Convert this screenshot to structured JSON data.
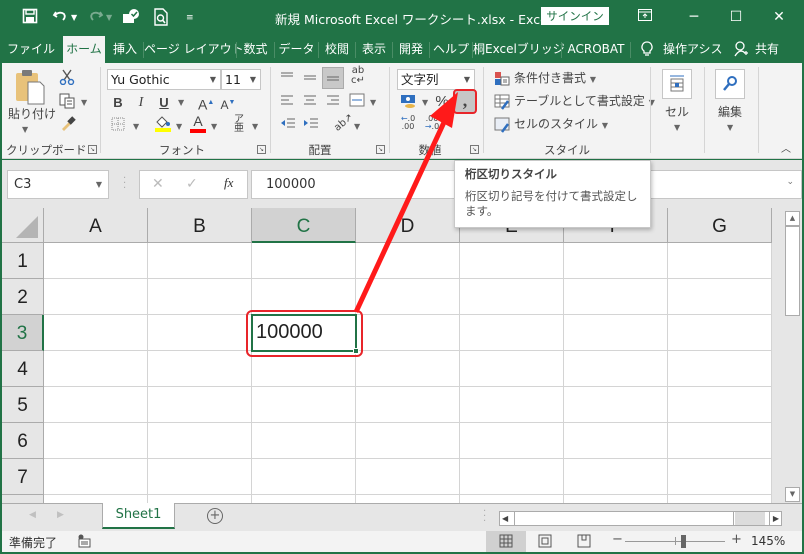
{
  "title_bar": {
    "title": "新規 Microsoft Excel ワークシート.xlsx  -  Excel",
    "signin_label": "サインイン",
    "quick_access": [
      "save",
      "undo",
      "redo",
      "touch-mode",
      "print-preview",
      "customize"
    ]
  },
  "tabs": [
    {
      "label": "ファイル",
      "active": false
    },
    {
      "label": "ホーム",
      "active": true
    },
    {
      "label": "挿入",
      "active": false
    },
    {
      "label": "ページ レイアウト",
      "active": false
    },
    {
      "label": "数式",
      "active": false
    },
    {
      "label": "データ",
      "active": false
    },
    {
      "label": "校閲",
      "active": false
    },
    {
      "label": "表示",
      "active": false
    },
    {
      "label": "開発",
      "active": false
    },
    {
      "label": "ヘルプ",
      "active": false
    },
    {
      "label": "桐Excelブリッジ",
      "active": false
    },
    {
      "label": "ACROBAT",
      "active": false
    },
    {
      "label": "操作アシス",
      "active": false
    },
    {
      "label": "共有",
      "active": false
    }
  ],
  "ribbon": {
    "clipboard": {
      "label": "クリップボード",
      "paste_label": "貼り付け"
    },
    "font": {
      "label": "フォント",
      "font_name": "Yu Gothic",
      "font_size": "11",
      "bold": "B",
      "italic": "I",
      "underline": "U",
      "grow": "A",
      "shrink": "A",
      "font_color_label": "A",
      "fill_color": "#ffff00",
      "font_color": "#ff0000"
    },
    "alignment": {
      "label": "配置"
    },
    "number": {
      "label": "数値",
      "format": "文字列",
      "percent": "%",
      "comma": ","
    },
    "styles": {
      "label": "スタイル",
      "conditional": "条件付き書式",
      "table": "テーブルとして書式設定",
      "cell_styles": "セルのスタイル"
    },
    "cells": {
      "label": "セル"
    },
    "editing": {
      "label": "編集"
    }
  },
  "formula_bar": {
    "name_box": "C3",
    "formula": "100000"
  },
  "grid": {
    "columns": [
      "A",
      "B",
      "C",
      "D",
      "E",
      "F",
      "G"
    ],
    "rows": [
      "1",
      "2",
      "3",
      "4",
      "5",
      "6",
      "7"
    ],
    "selected_column": "C",
    "selected_row": "3",
    "active_cell_value": "100000"
  },
  "tooltip": {
    "title": "桁区切りスタイル",
    "body": "桁区切り記号を付けて書式設定します。"
  },
  "sheets": [
    {
      "name": "Sheet1",
      "active": true
    }
  ],
  "status_bar": {
    "status": "準備完了",
    "zoom": "145%"
  },
  "annotation_color": "#ff0000",
  "accent_color": "#217346"
}
